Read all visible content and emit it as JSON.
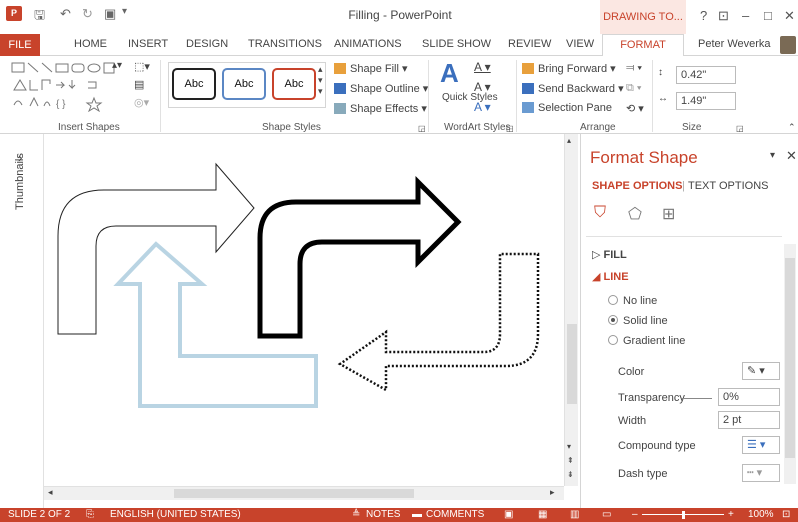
{
  "title_bar": {
    "app_logo": "P",
    "title": "Filling - PowerPoint",
    "drawing_tools": "DRAWING TO...",
    "help": "?",
    "ribbon_display": "⊡",
    "minimize": "–",
    "maximize": "□",
    "close": "✕"
  },
  "tabs": {
    "file": "FILE",
    "items": [
      "HOME",
      "INSERT",
      "DESIGN",
      "TRANSITIONS",
      "ANIMATIONS",
      "SLIDE SHOW",
      "REVIEW",
      "VIEW"
    ],
    "format": "FORMAT",
    "user": "Peter Weverka"
  },
  "ribbon": {
    "insert_shapes_label": "Insert Shapes",
    "shape_styles_label": "Shape Styles",
    "style_samples": [
      "Abc",
      "Abc",
      "Abc"
    ],
    "shape_fill": "Shape Fill",
    "shape_outline": "Shape Outline",
    "shape_effects": "Shape Effects",
    "quick_styles": "Quick Styles",
    "wordart_label": "WordArt Styles",
    "bring_forward": "Bring Forward",
    "send_backward": "Send Backward",
    "selection_pane": "Selection Pane",
    "arrange_label": "Arrange",
    "height": "0.42\"",
    "width": "1.49\"",
    "size_label": "Size"
  },
  "left_pane": {
    "label": "Thumbnails",
    "expand": "›"
  },
  "format_pane": {
    "title": "Format Shape",
    "shape_options": "SHAPE OPTIONS",
    "text_options": "TEXT OPTIONS",
    "fill": "FILL",
    "line": "LINE",
    "no_line": "No line",
    "solid_line": "Solid line",
    "gradient_line": "Gradient line",
    "color": "Color",
    "transparency": "Transparency",
    "transparency_value": "0%",
    "width": "Width",
    "width_value": "2 pt",
    "compound_type": "Compound type",
    "dash_type": "Dash type"
  },
  "status": {
    "slide": "SLIDE 2 OF 2",
    "language": "ENGLISH (UNITED STATES)",
    "notes": "NOTES",
    "comments": "COMMENTS",
    "zoom": "100%"
  },
  "colors": {
    "accent": "#c8432b",
    "light_blue": "#b9d4e3"
  }
}
